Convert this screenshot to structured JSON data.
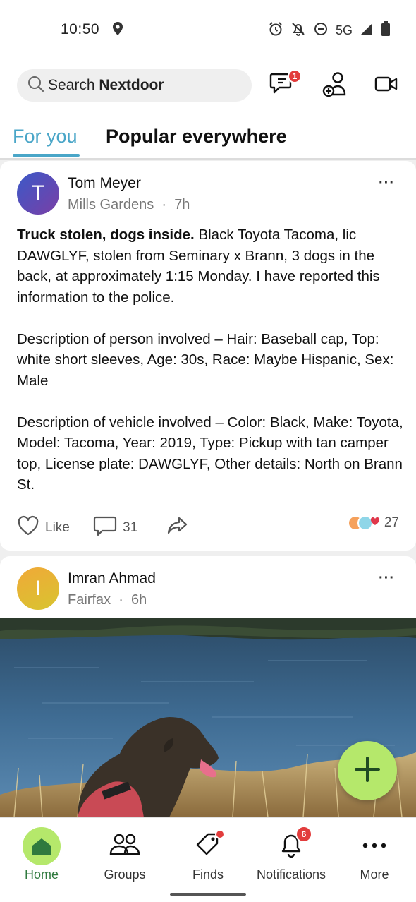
{
  "status_bar": {
    "time": "10:50",
    "network": "5G",
    "icons": [
      "location-icon",
      "alarm-icon",
      "notifications-off-icon",
      "do-not-disturb-icon",
      "signal-icon",
      "battery-icon"
    ]
  },
  "header": {
    "search_prefix": "Search ",
    "search_brand": "Nextdoor",
    "messages_badge": "1",
    "icons": [
      "search-icon",
      "messages-icon",
      "add-neighbor-icon",
      "video-icon"
    ]
  },
  "tabs": [
    {
      "label": "For you",
      "active": true
    },
    {
      "label": "Popular everywhere",
      "active": false
    }
  ],
  "posts": [
    {
      "avatar_letter": "T",
      "author": "Tom Meyer",
      "neighborhood": "Mills Gardens",
      "separator": "·",
      "time": "7h",
      "more": "···",
      "title": "Truck stolen, dogs inside.",
      "paragraph1": " Black Toyota Tacoma, lic DAWGLYF, stolen from Seminary x Brann, 3 dogs in the back, at approximately 1:15 Monday. I have reported this information to the police.",
      "paragraph2": "Description of person involved – Hair: Baseball cap, Top: white short sleeves, Age: 30s, Race: Maybe Hispanic, Sex: Male",
      "paragraph3": "Description of vehicle involved – Color: Black, Make: Toyota, Model: Tacoma, Year: 2019, Type: Pickup with tan camper top, License plate: DAWGLYF, Other details: North on Brann St.",
      "like_label": "Like",
      "comment_count": "31",
      "reaction_count": "27"
    },
    {
      "avatar_letter": "I",
      "author": "Imran Ahmad",
      "neighborhood": "Fairfax",
      "separator": "·",
      "time": "6h",
      "more": "···"
    }
  ],
  "bottom_nav": [
    {
      "label": "Home",
      "icon": "home-icon",
      "active": true
    },
    {
      "label": "Groups",
      "icon": "groups-icon"
    },
    {
      "label": "Finds",
      "icon": "tag-icon",
      "dot": true
    },
    {
      "label": "Notifications",
      "icon": "bell-icon",
      "badge": "6"
    },
    {
      "label": "More",
      "icon": "more-icon"
    }
  ],
  "colors": {
    "accent": "#4aa6c8",
    "brand_green": "#b5e86b",
    "home_label": "#2f7a3e",
    "badge_red": "#e23c3c"
  }
}
